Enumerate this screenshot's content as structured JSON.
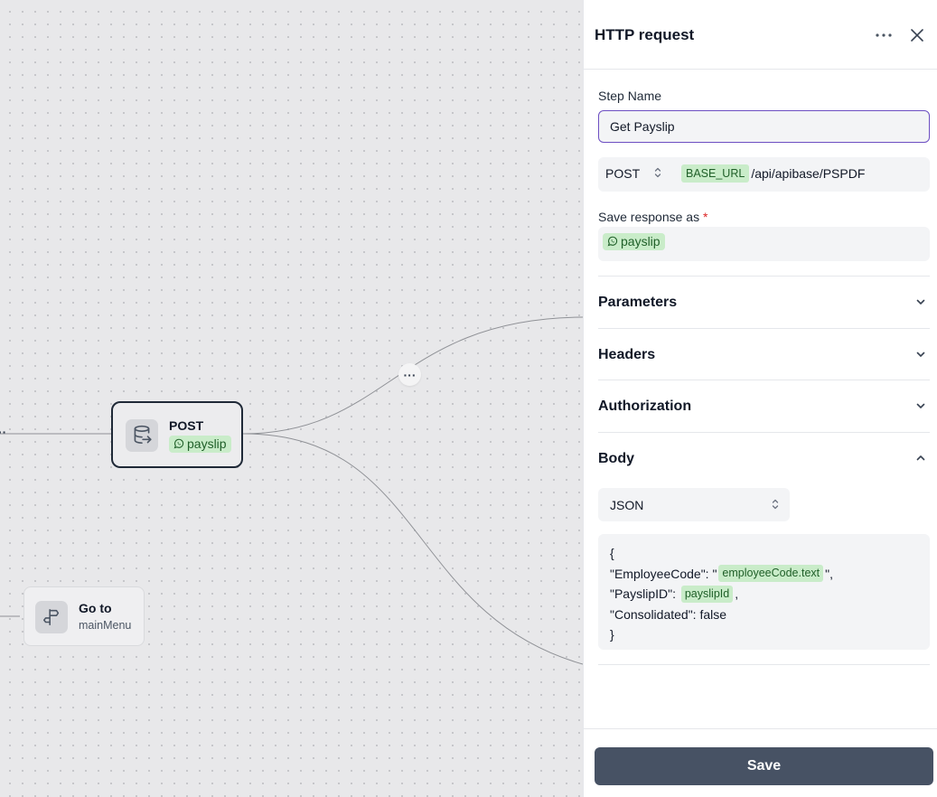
{
  "canvas": {
    "post_node": {
      "title": "POST",
      "variable": "payslip",
      "icon": "database-import-icon",
      "var_icon": "whatsapp-icon"
    },
    "goto_node": {
      "title": "Go to",
      "subtitle": "mainMenu",
      "icon": "signpost-icon"
    },
    "edge_menu": "···",
    "left_edge_menu": "··"
  },
  "panel": {
    "title": "HTTP request",
    "more_icon": "more-horizontal-icon",
    "close_icon": "close-icon",
    "step_name_label": "Step Name",
    "step_name_value": "Get Payslip",
    "method": "POST",
    "method_options": [
      "POST"
    ],
    "url_variable": "BASE_URL",
    "url_path": "/api/apibase/PSPDF",
    "save_response_label": "Save response as",
    "required_mark": "*",
    "save_response_variable": "payslip",
    "sections": {
      "parameters": "Parameters",
      "headers": "Headers",
      "authorization": "Authorization",
      "body": "Body"
    },
    "body_type": "JSON",
    "body_code": {
      "open_brace": "{",
      "line1_key": "\"EmployeeCode\": \"",
      "line1_var": "employeeCode.text",
      "line1_end": "\",",
      "line2_key": "\"PayslipID\": ",
      "line2_var": "payslipId",
      "line2_end": ",",
      "line3": "\"Consolidated\": false",
      "close_brace": "}"
    },
    "save_label": "Save"
  },
  "colors": {
    "accent_border": "#6d4fc2",
    "variable_pill_bg": "#c9ecc9",
    "variable_pill_text": "#1f5f28",
    "save_button_bg": "#475264",
    "required": "#dc2626"
  }
}
